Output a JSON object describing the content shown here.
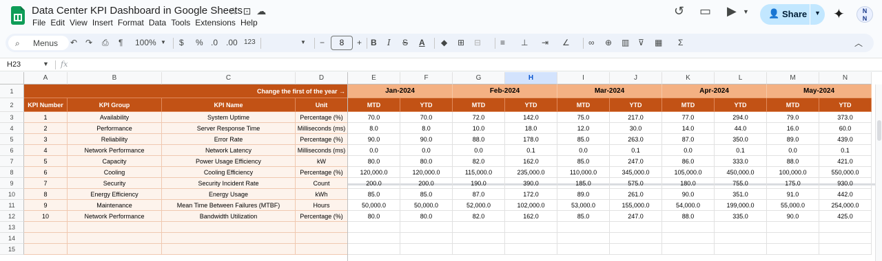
{
  "app": {
    "doc_title": "Data Center KPI Dashboard in Google Sheets",
    "menu": [
      "File",
      "Edit",
      "View",
      "Insert",
      "Format",
      "Data",
      "Tools",
      "Extensions",
      "Help"
    ],
    "share_label": "Share",
    "avatar_text": "N"
  },
  "toolbar": {
    "menus_label": "Menus",
    "zoom": "100%",
    "currency": "$",
    "percent": "%",
    "dec_decrease": ".0",
    "dec_increase": ".00",
    "format_123": "123",
    "font_size": "8",
    "minus": "−",
    "plus": "+"
  },
  "formula_bar": {
    "name_box": "H23",
    "fx": "fx",
    "formula": ""
  },
  "columns": [
    "A",
    "B",
    "C",
    "D",
    "E",
    "F",
    "G",
    "H",
    "I",
    "J",
    "K",
    "L",
    "M",
    "N"
  ],
  "selected_column": "H",
  "row_numbers": [
    "1",
    "2",
    "3",
    "4",
    "5",
    "6",
    "7",
    "8",
    "9",
    "10",
    "11",
    "12",
    "13",
    "14",
    "15"
  ],
  "sheet": {
    "banner": "Change the first of the year →",
    "months": [
      "Jan-2024",
      "Feb-2024",
      "Mar-2024",
      "Apr-2024",
      "May-2024"
    ],
    "headers": [
      "KPI Number",
      "KPI Group",
      "KPI Name",
      "Unit"
    ],
    "sub_headers": [
      "MTD",
      "YTD"
    ],
    "rows": [
      [
        "1",
        "Availability",
        "System Uptime",
        "Percentage (%)",
        "70.0",
        "70.0",
        "72.0",
        "142.0",
        "75.0",
        "217.0",
        "77.0",
        "294.0",
        "79.0",
        "373.0"
      ],
      [
        "2",
        "Performance",
        "Server Response Time",
        "Milliseconds (ms)",
        "8.0",
        "8.0",
        "10.0",
        "18.0",
        "12.0",
        "30.0",
        "14.0",
        "44.0",
        "16.0",
        "60.0"
      ],
      [
        "3",
        "Reliability",
        "Error Rate",
        "Percentage (%)",
        "90.0",
        "90.0",
        "88.0",
        "178.0",
        "85.0",
        "263.0",
        "87.0",
        "350.0",
        "89.0",
        "439.0"
      ],
      [
        "4",
        "Network Performance",
        "Network Latency",
        "Milliseconds (ms)",
        "0.0",
        "0.0",
        "0.0",
        "0.1",
        "0.0",
        "0.1",
        "0.0",
        "0.1",
        "0.0",
        "0.1"
      ],
      [
        "5",
        "Capacity",
        "Power Usage Efficiency",
        "kW",
        "80.0",
        "80.0",
        "82.0",
        "162.0",
        "85.0",
        "247.0",
        "86.0",
        "333.0",
        "88.0",
        "421.0"
      ],
      [
        "6",
        "Cooling",
        "Cooling Efficiency",
        "Percentage (%)",
        "120,000.0",
        "120,000.0",
        "115,000.0",
        "235,000.0",
        "110,000.0",
        "345,000.0",
        "105,000.0",
        "450,000.0",
        "100,000.0",
        "550,000.0"
      ],
      [
        "7",
        "Security",
        "Security Incident Rate",
        "Count",
        "200.0",
        "200.0",
        "190.0",
        "390.0",
        "185.0",
        "575.0",
        "180.0",
        "755.0",
        "175.0",
        "930.0"
      ],
      [
        "8",
        "Energy Efficiency",
        "Energy Usage",
        "kWh",
        "85.0",
        "85.0",
        "87.0",
        "172.0",
        "89.0",
        "261.0",
        "90.0",
        "351.0",
        "91.0",
        "442.0"
      ],
      [
        "9",
        "Maintenance",
        "Mean Time Between Failures (MTBF)",
        "Hours",
        "50,000.0",
        "50,000.0",
        "52,000.0",
        "102,000.0",
        "53,000.0",
        "155,000.0",
        "54,000.0",
        "199,000.0",
        "55,000.0",
        "254,000.0"
      ],
      [
        "10",
        "Network Performance",
        "Bandwidth Utilization",
        "Percentage (%)",
        "80.0",
        "80.0",
        "82.0",
        "162.0",
        "85.0",
        "247.0",
        "88.0",
        "335.0",
        "90.0",
        "425.0"
      ]
    ]
  },
  "colors": {
    "header_dark": "#c25215",
    "header_light": "#f4b183",
    "info_fill": "#fdf3ec",
    "share_bg": "#c2e7ff",
    "sheets_green": "#0f9d58"
  }
}
